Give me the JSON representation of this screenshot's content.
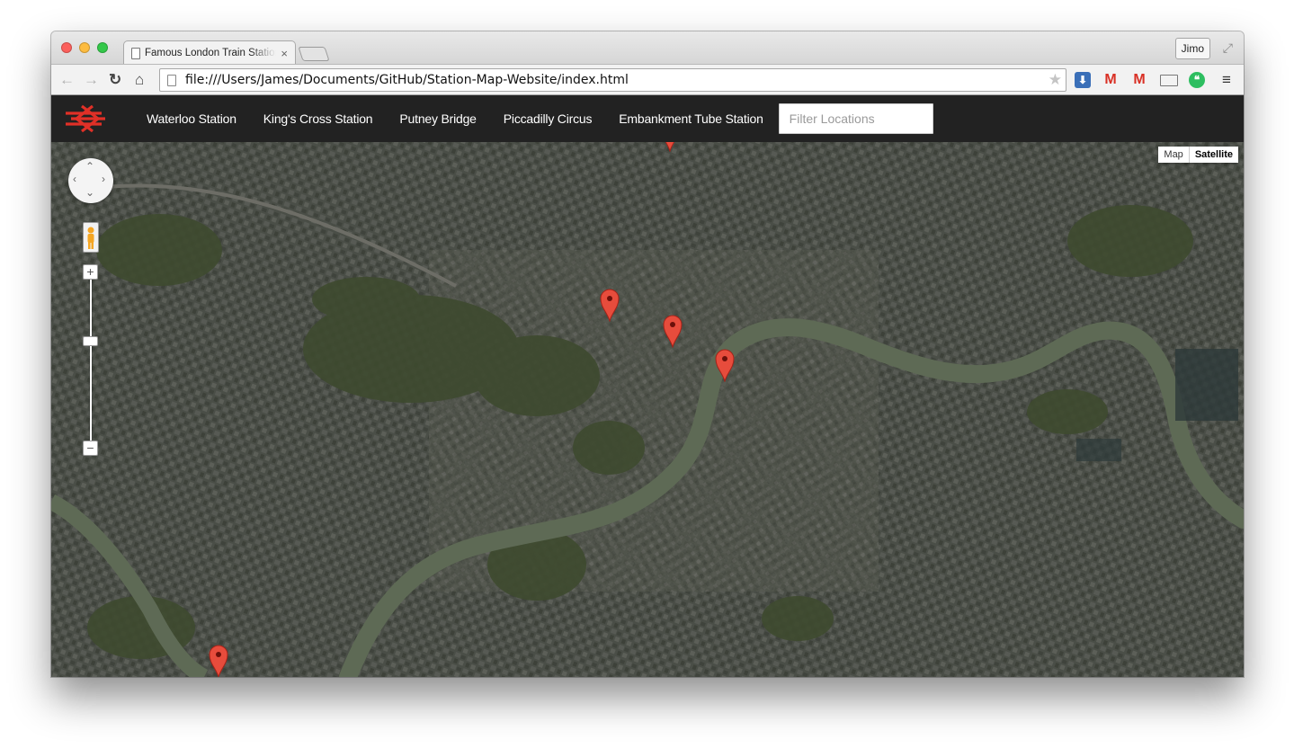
{
  "browser": {
    "tab_title": "Famous London Train Stations",
    "tab_close": "×",
    "profile_name": "Jimo",
    "url": "file:///Users/James/Documents/GitHub/Station-Map-Website/index.html",
    "icons": [
      "back-icon",
      "forward-icon",
      "reload-icon",
      "home-icon",
      "star-icon",
      "fullscreen-icon"
    ],
    "extensions": [
      "download-extension-icon",
      "gmail-icon",
      "gmail-checker-icon",
      "cast-icon",
      "evernote-icon",
      "menu-icon"
    ]
  },
  "navbar": {
    "logo": "british-rail-logo",
    "links": [
      "Waterloo Station",
      "King's Cross Station",
      "Putney Bridge",
      "Piccadilly Circus",
      "Embankment Tube Station"
    ],
    "filter_placeholder": "Filter Locations"
  },
  "map": {
    "type_options": [
      "Map",
      "Satellite"
    ],
    "selected_type": "Satellite",
    "zoom_plus": "+",
    "zoom_minus": "−",
    "marker_count": 5,
    "colors": {
      "marker": "#e74c3c",
      "logo": "#e03027",
      "navbar": "#222222",
      "river": "#5e6a55"
    }
  }
}
